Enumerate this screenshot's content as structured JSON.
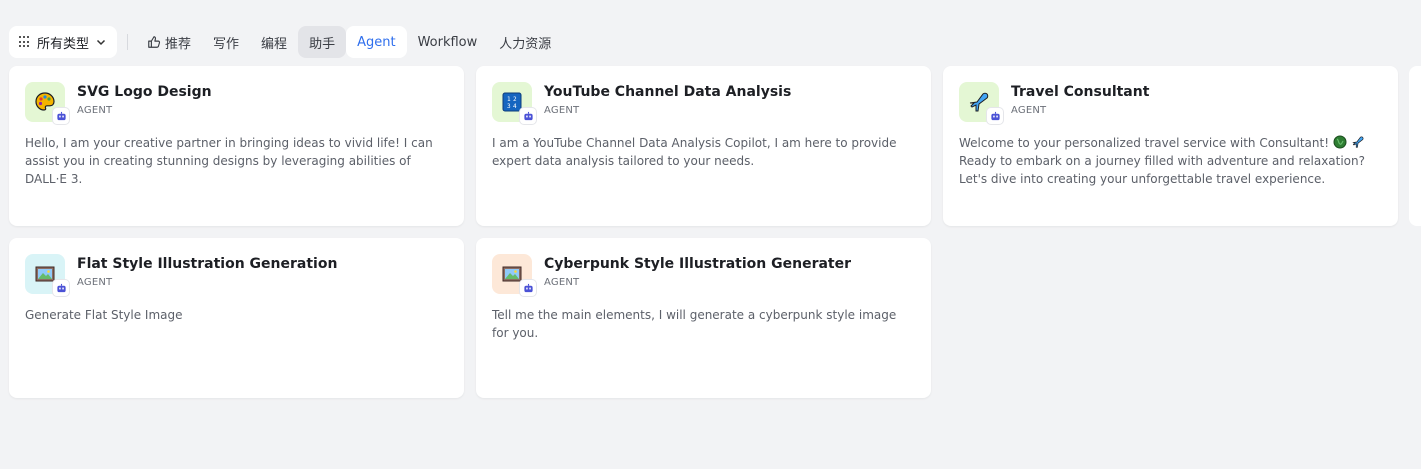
{
  "filter": {
    "type_select_label": "所有类型"
  },
  "tabs": [
    {
      "label": "推荐"
    },
    {
      "label": "写作"
    },
    {
      "label": "编程"
    },
    {
      "label": "助手"
    },
    {
      "label": "Agent"
    },
    {
      "label": "Workflow"
    },
    {
      "label": "人力资源"
    }
  ],
  "active_tab": "Agent",
  "cards": [
    {
      "title": "SVG Logo Design",
      "type": "AGENT",
      "icon": "palette-icon",
      "avatar_bg": "#e4f7d4",
      "description": "Hello, I am your creative partner in bringing ideas to vivid life! I can assist you in creating stunning designs by leveraging abilities of DALL·E 3."
    },
    {
      "title": "YouTube Channel Data Analysis",
      "type": "AGENT",
      "icon": "numbers-icon",
      "avatar_bg": "#e4f7d4",
      "description": "I am a YouTube Channel Data Analysis Copilot, I am here to provide expert data analysis tailored to your needs."
    },
    {
      "title": "Travel Consultant",
      "type": "AGENT",
      "icon": "airplane-icon",
      "avatar_bg": "#e4f7d4",
      "description_line1": "Welcome to your personalized travel service with Consultant!",
      "description_rest": "Ready to embark on a journey filled with adventure and relaxation? Let's dive into creating your unforgettable travel experience."
    },
    {
      "title": "Flat Style Illustration Generation",
      "type": "AGENT",
      "icon": "framed-picture-icon",
      "avatar_bg": "#d9f4f7",
      "description": "Generate Flat Style Image"
    },
    {
      "title": "Cyberpunk Style Illustration Generater",
      "type": "AGENT",
      "icon": "framed-picture-icon",
      "avatar_bg": "#fde8d8",
      "description": "Tell me the main elements, I will generate a cyberpunk style image for you."
    }
  ],
  "colors": {
    "accent": "#2f6fed",
    "page_bg": "#f2f3f5",
    "card_bg": "#ffffff",
    "bot_badge": "#4b52d6"
  }
}
